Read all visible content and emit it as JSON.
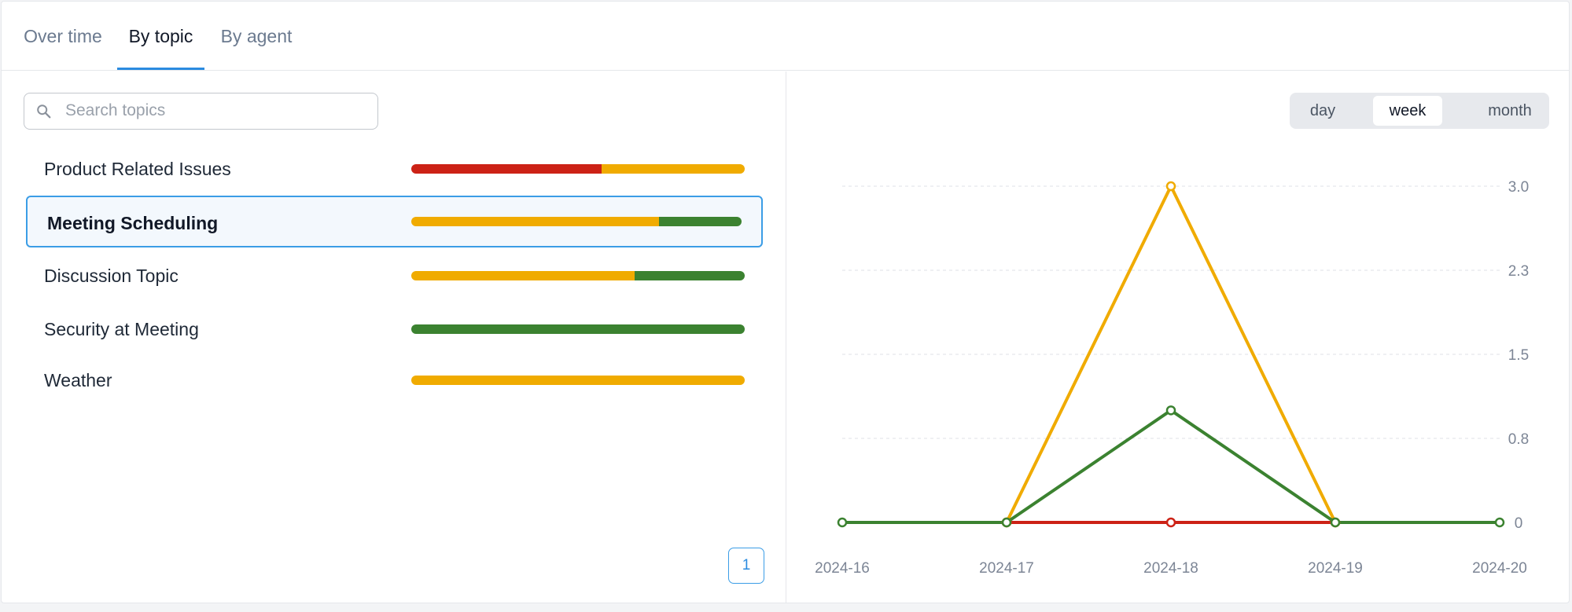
{
  "tabs": [
    {
      "label": "Over time",
      "active": false
    },
    {
      "label": "By topic",
      "active": true
    },
    {
      "label": "By agent",
      "active": false
    }
  ],
  "search": {
    "placeholder": "Search topics",
    "value": "",
    "icon": "search-icon"
  },
  "colors": {
    "negative": "#cc2216",
    "neutral": "#f0ab00",
    "positive": "#3b8230",
    "accent": "#2b8be0"
  },
  "topics": [
    {
      "label": "Product Related Issues",
      "selected": false,
      "segments": [
        {
          "color": "#cc2216",
          "fraction": 0.57
        },
        {
          "color": "#f0ab00",
          "fraction": 0.43
        }
      ]
    },
    {
      "label": "Meeting Scheduling",
      "selected": true,
      "segments": [
        {
          "color": "#f0ab00",
          "fraction": 0.75
        },
        {
          "color": "#3b8230",
          "fraction": 0.25
        }
      ]
    },
    {
      "label": "Discussion Topic",
      "selected": false,
      "segments": [
        {
          "color": "#f0ab00",
          "fraction": 0.67
        },
        {
          "color": "#3b8230",
          "fraction": 0.33
        }
      ]
    },
    {
      "label": "Security at Meeting",
      "selected": false,
      "segments": [
        {
          "color": "#3b8230",
          "fraction": 1.0
        }
      ]
    },
    {
      "label": "Weather",
      "selected": false,
      "segments": [
        {
          "color": "#f0ab00",
          "fraction": 1.0
        }
      ]
    }
  ],
  "pagination": {
    "current": "1"
  },
  "period": {
    "options": [
      {
        "label": "day",
        "active": false
      },
      {
        "label": "week",
        "active": true
      },
      {
        "label": "month",
        "active": false
      }
    ]
  },
  "chart_data": {
    "type": "line",
    "x": [
      "2024-16",
      "2024-17",
      "2024-18",
      "2024-19",
      "2024-20"
    ],
    "yticks": [
      "0",
      "0.8",
      "1.5",
      "2.3",
      "3.0"
    ],
    "ylim": [
      0,
      3
    ],
    "grid": true,
    "y_axis_side": "right",
    "series": [
      {
        "color": "#cc2216",
        "values": [
          null,
          0,
          0,
          0,
          null
        ]
      },
      {
        "color": "#f0ab00",
        "values": [
          null,
          0,
          3,
          0,
          null
        ]
      },
      {
        "color": "#3b8230",
        "values": [
          0,
          0,
          1,
          0,
          0
        ]
      }
    ]
  }
}
